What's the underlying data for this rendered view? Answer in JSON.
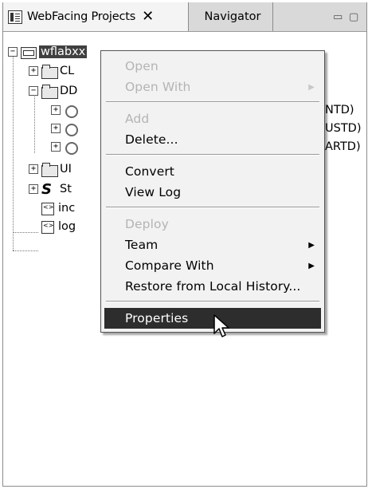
{
  "tabs": {
    "active_label": "WebFacing Projects",
    "close_glyph": "✕",
    "second_label": "Navigator"
  },
  "window_buttons": {
    "minimize": "▭",
    "maximize": "▢"
  },
  "tree": {
    "root": {
      "label": "wflabxx",
      "expander": "−"
    },
    "items": [
      {
        "label": "CL",
        "expander": "+"
      },
      {
        "label": "DD",
        "expander": "−"
      },
      {
        "label": "",
        "suffix": "NTD)",
        "expander": "+"
      },
      {
        "label": "",
        "suffix": "USTD)",
        "expander": "+"
      },
      {
        "label": "",
        "suffix": "ARTD)",
        "expander": "+"
      },
      {
        "label": "UI",
        "expander": "+"
      },
      {
        "label": "St",
        "expander": "+"
      },
      {
        "label": "inc"
      },
      {
        "label": "log"
      }
    ]
  },
  "context_menu": {
    "items": [
      {
        "label": "Open",
        "enabled": false
      },
      {
        "label": "Open With",
        "enabled": false,
        "submenu": true
      },
      {
        "label": "Add",
        "enabled": false
      },
      {
        "label": "Delete...",
        "enabled": true
      },
      {
        "label": "Convert",
        "enabled": true
      },
      {
        "label": "View Log",
        "enabled": true
      },
      {
        "label": "Deploy",
        "enabled": false
      },
      {
        "label": "Team",
        "enabled": true,
        "submenu": true
      },
      {
        "label": "Compare With",
        "enabled": true,
        "submenu": true
      },
      {
        "label": "Restore from Local History...",
        "enabled": true
      },
      {
        "label": "Properties",
        "enabled": true,
        "highlighted": true
      }
    ],
    "submenu_arrow": "▶"
  },
  "colors": {
    "highlight": "#2d2d2d",
    "menu_bg": "#f2f2f2",
    "disabled_text": "#b4b4b4"
  }
}
